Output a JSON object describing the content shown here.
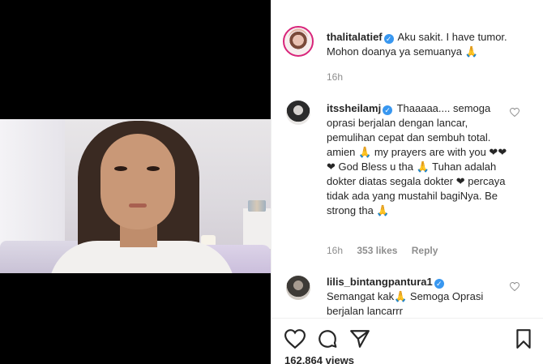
{
  "post": {
    "owner": {
      "username": "thalitalatief",
      "caption": "Aku sakit. I have tumor. Mohon doanya ya semuanya 🙏",
      "time": "16h"
    },
    "comments": [
      {
        "username": "itssheilamj",
        "text": "Thaaaaa.... semoga oprasi berjalan dengan lancar, pemulihan cepat dan sembuh total. amien 🙏 my prayers are with you ❤❤❤ God Bless u tha 🙏 Tuhan adalah dokter diatas segala dokter ❤ percaya tidak ada yang mustahil bagiNya. Be strong tha 🙏",
        "time": "16h",
        "likes": "353 likes",
        "reply": "Reply"
      },
      {
        "username": "lilis_bintangpantura1",
        "text": "Semangat kak🙏 Semoga Oprasi berjalan lancarrr"
      }
    ],
    "views": "162,864 views"
  },
  "icons": {
    "verified": "verified-badge-icon",
    "like": "heart-icon",
    "comment": "comment-bubble-icon",
    "share": "paper-plane-icon",
    "save": "bookmark-icon"
  },
  "colors": {
    "accent_blue": "#3897f0",
    "story_ring": "#d8247a",
    "secondary_text": "#8e8e8e",
    "primary_text": "#262626"
  }
}
